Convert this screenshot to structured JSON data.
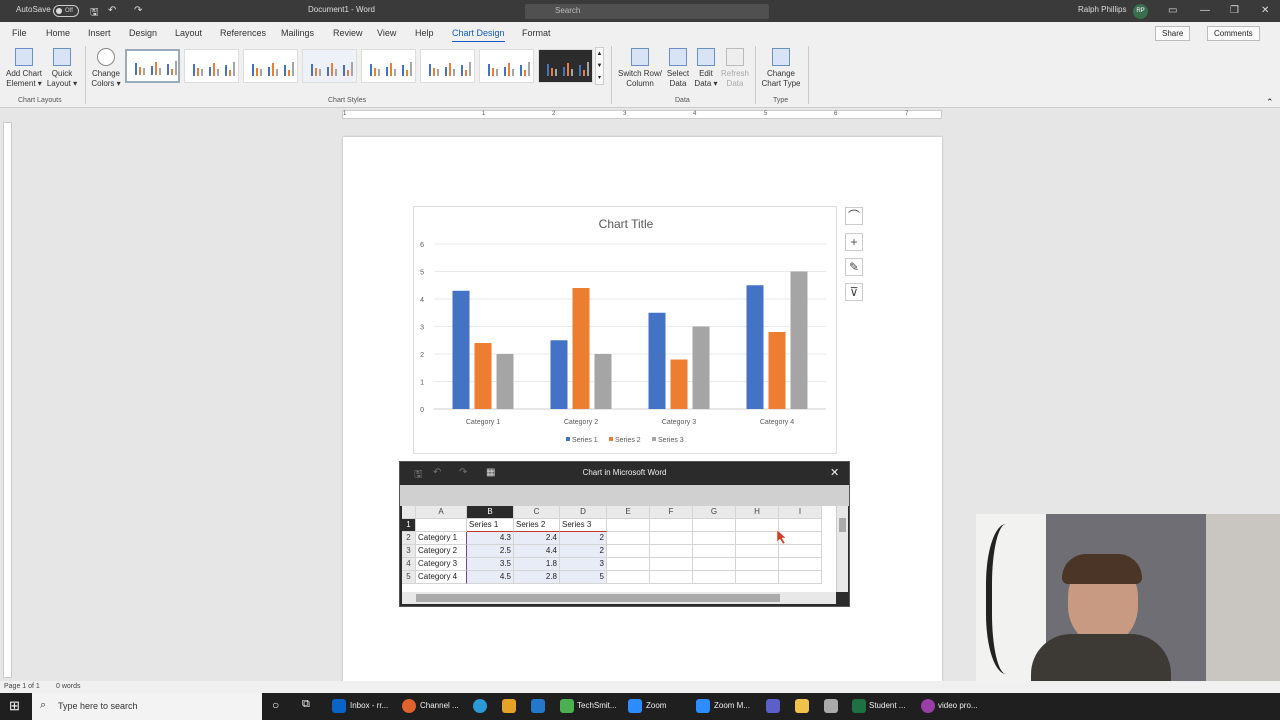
{
  "titlebar": {
    "autosave": "AutoSave",
    "toggle": "Off",
    "doc_title": "Document1 - Word",
    "search_placeholder": "Search",
    "user": "Ralph Phillips",
    "initials": "RP"
  },
  "menu": {
    "items": [
      "File",
      "Home",
      "Insert",
      "Design",
      "Layout",
      "References",
      "Mailings",
      "Review",
      "View",
      "Help",
      "Chart Design",
      "Format"
    ],
    "active": "Chart Design",
    "share": "Share",
    "comments": "Comments"
  },
  "ribbon": {
    "add_chart_element": [
      "Add Chart",
      "Element ▾"
    ],
    "quick_layout": [
      "Quick",
      "Layout ▾"
    ],
    "change_colors": [
      "Change",
      "Colors ▾"
    ],
    "switch_row_column": [
      "Switch Row/",
      "Column"
    ],
    "select_data": [
      "Select",
      "Data"
    ],
    "edit_data": [
      "Edit",
      "Data ▾"
    ],
    "refresh_data": [
      "Refresh",
      "Data"
    ],
    "change_chart_type": [
      "Change",
      "Chart Type"
    ],
    "groups": {
      "chart_layouts": "Chart Layouts",
      "chart_styles": "Chart Styles",
      "data": "Data",
      "type": "Type"
    }
  },
  "ruler": {
    "marks": [
      "1",
      "1",
      "2",
      "3",
      "4",
      "5",
      "6",
      "7"
    ]
  },
  "chart_data": {
    "type": "bar",
    "title": "Chart Title",
    "categories": [
      "Category 1",
      "Category 2",
      "Category 3",
      "Category 4"
    ],
    "series": [
      {
        "name": "Series 1",
        "values": [
          4.3,
          2.5,
          3.5,
          4.5
        ],
        "color": "#4472c4"
      },
      {
        "name": "Series 2",
        "values": [
          2.4,
          4.4,
          1.8,
          2.8
        ],
        "color": "#ed7d31"
      },
      {
        "name": "Series 3",
        "values": [
          2,
          2,
          3,
          5
        ],
        "color": "#a5a5a5"
      }
    ],
    "ylim": [
      0,
      6
    ],
    "yticks": [
      "0",
      "1",
      "2",
      "3",
      "4",
      "5",
      "6"
    ],
    "grid": true,
    "legend": "bottom"
  },
  "sheet": {
    "title": "Chart in Microsoft Word",
    "col_headers": [
      "A",
      "B",
      "C",
      "D",
      "E",
      "F",
      "G",
      "H",
      "I"
    ],
    "row_headers": [
      "1",
      "2",
      "3",
      "4",
      "5"
    ],
    "rows": [
      [
        "",
        "Series 1",
        "Series 2",
        "Series 3"
      ],
      [
        "Category 1",
        "4.3",
        "2.4",
        "2"
      ],
      [
        "Category 2",
        "2.5",
        "4.4",
        "2"
      ],
      [
        "Category 3",
        "3.5",
        "1.8",
        "3"
      ],
      [
        "Category 4",
        "4.5",
        "2.8",
        "5"
      ]
    ]
  },
  "status": {
    "page": "Page 1 of 1",
    "words": "0 words"
  },
  "taskbar": {
    "search": "Type here to search",
    "apps": [
      "Inbox - rr...",
      "Channel ...",
      "TechSmit...",
      "Zoom",
      "Zoom M...",
      "Student ...",
      "video pro..."
    ]
  }
}
